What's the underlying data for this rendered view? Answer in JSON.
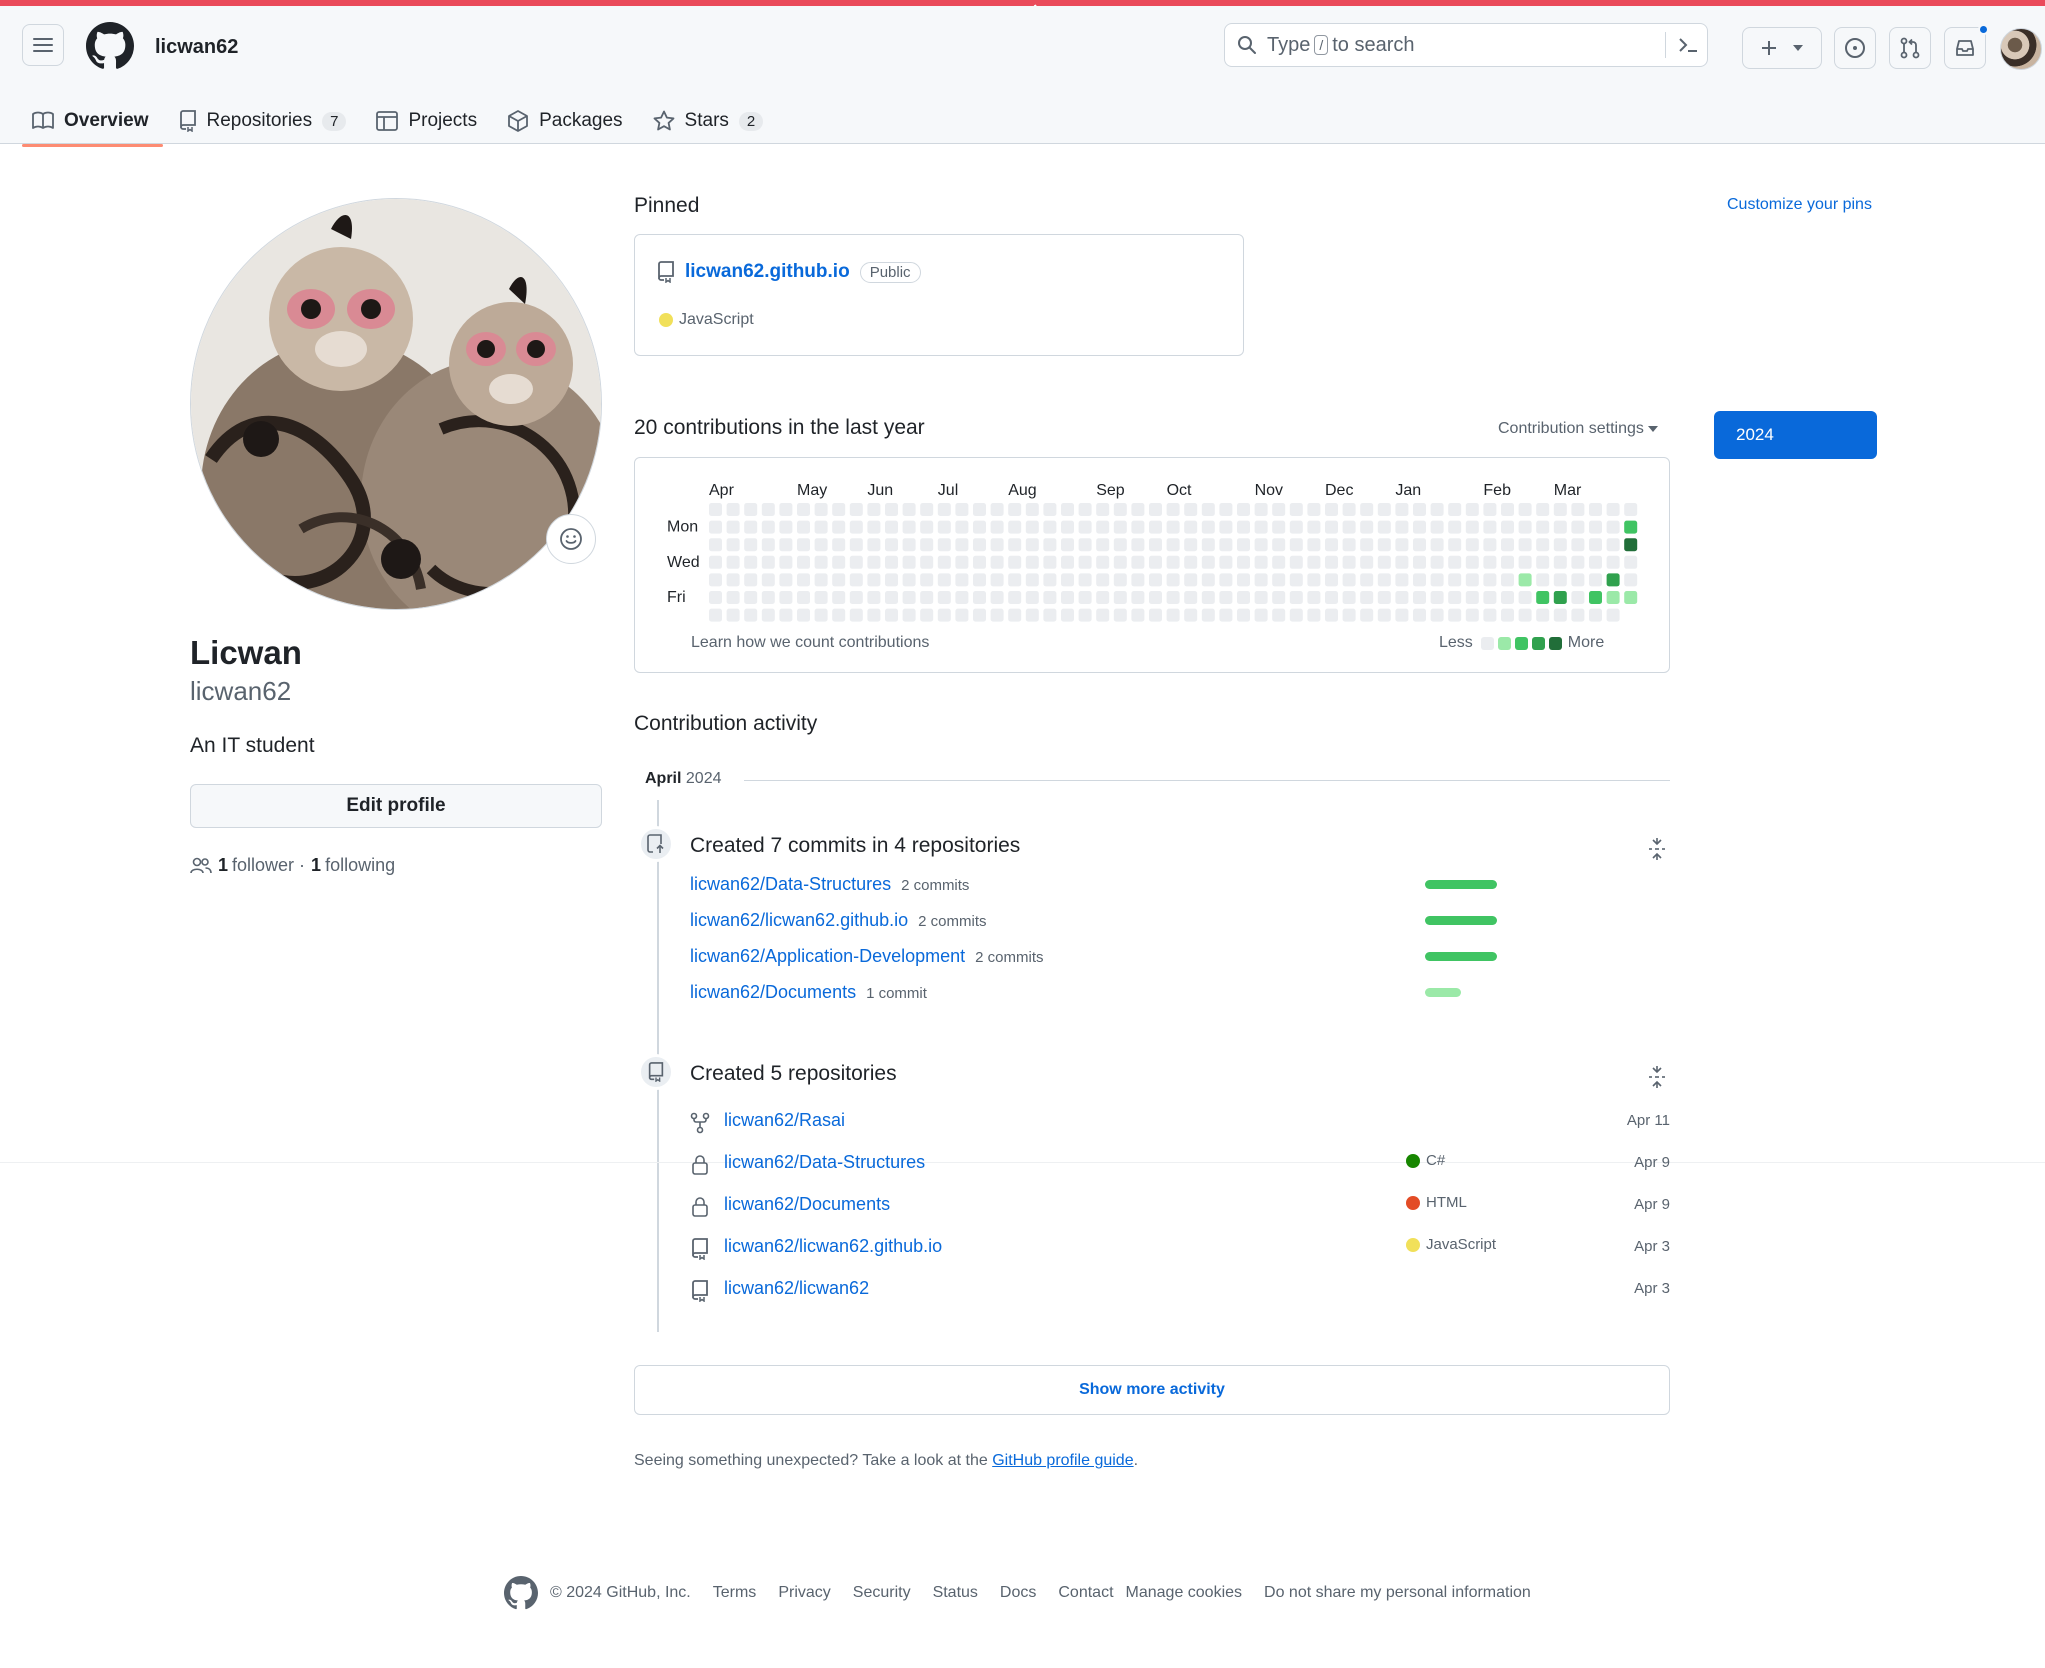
{
  "header": {
    "username": "licwan62",
    "search": {
      "prefix": "Type",
      "slash": "/",
      "suffix": "to search"
    }
  },
  "tabs": [
    {
      "label": "Overview",
      "icon": "book-icon"
    },
    {
      "label": "Repositories",
      "icon": "repo-icon",
      "count": "7"
    },
    {
      "label": "Projects",
      "icon": "table-icon"
    },
    {
      "label": "Packages",
      "icon": "package-icon"
    },
    {
      "label": "Stars",
      "icon": "star-icon",
      "count": "2"
    }
  ],
  "profile": {
    "name": "Licwan",
    "username": "licwan62",
    "bio": "An IT student",
    "edit_label": "Edit profile",
    "followers": "1",
    "followers_label": "follower",
    "following": "1",
    "following_label": "following"
  },
  "pinned": {
    "title": "Pinned",
    "customize": "Customize your pins",
    "repo": "licwan62.github.io",
    "visibility": "Public",
    "language": "JavaScript",
    "language_color": "#f1e05a"
  },
  "contributions": {
    "title": "20 contributions in the last year",
    "settings": "Contribution settings",
    "year": "2024",
    "months": [
      "Apr",
      "May",
      "Jun",
      "Jul",
      "Aug",
      "Sep",
      "Oct",
      "Nov",
      "Dec",
      "Jan",
      "Feb",
      "Mar"
    ],
    "days": [
      "Mon",
      "Wed",
      "Fri"
    ],
    "learn": "Learn how we count contributions",
    "less": "Less",
    "more": "More",
    "level_colors": [
      "#ebedf0",
      "#9be9a8",
      "#40c463",
      "#30a14e",
      "#216e39"
    ],
    "active_cells": [
      {
        "week": 46,
        "day": 4,
        "level": 1
      },
      {
        "week": 47,
        "day": 5,
        "level": 2
      },
      {
        "week": 48,
        "day": 5,
        "level": 3
      },
      {
        "week": 50,
        "day": 5,
        "level": 2
      },
      {
        "week": 51,
        "day": 4,
        "level": 3
      },
      {
        "week": 51,
        "day": 5,
        "level": 1
      },
      {
        "week": 52,
        "day": 1,
        "level": 2
      },
      {
        "week": 52,
        "day": 2,
        "level": 4
      },
      {
        "week": 52,
        "day": 5,
        "level": 1
      }
    ]
  },
  "activity": {
    "title": "Contribution activity",
    "month": "April",
    "year": "2024",
    "commits_title": "Created 7 commits in 4 repositories",
    "commits": [
      {
        "repo": "licwan62/Data-Structures",
        "count": "2 commits",
        "fraction": 1.0,
        "color": "#40c463"
      },
      {
        "repo": "licwan62/licwan62.github.io",
        "count": "2 commits",
        "fraction": 1.0,
        "color": "#40c463"
      },
      {
        "repo": "licwan62/Application-Development",
        "count": "2 commits",
        "fraction": 1.0,
        "color": "#40c463"
      },
      {
        "repo": "licwan62/Documents",
        "count": "1 commit",
        "fraction": 0.5,
        "color": "#9be9a8"
      }
    ],
    "repos_title": "Created 5 repositories",
    "repos": [
      {
        "name": "licwan62/Rasai",
        "icon": "fork-icon",
        "language": "",
        "language_color": "",
        "date": "Apr 11"
      },
      {
        "name": "licwan62/Data-Structures",
        "icon": "lock-icon",
        "language": "C#",
        "language_color": "#178600",
        "date": "Apr 9"
      },
      {
        "name": "licwan62/Documents",
        "icon": "lock-icon",
        "language": "HTML",
        "language_color": "#e34c26",
        "date": "Apr 9"
      },
      {
        "name": "licwan62/licwan62.github.io",
        "icon": "repo-icon",
        "language": "JavaScript",
        "language_color": "#f1e05a",
        "date": "Apr 3"
      },
      {
        "name": "licwan62/licwan62",
        "icon": "repo-icon",
        "language": "",
        "language_color": "",
        "date": "Apr 3"
      }
    ],
    "show_more": "Show more activity",
    "unexpected_text": "Seeing something unexpected? Take a look at the",
    "unexpected_link": "GitHub profile guide",
    "unexpected_end": "."
  },
  "footer": {
    "copyright": "© 2024 GitHub, Inc.",
    "links": [
      "Terms",
      "Privacy",
      "Security",
      "Status",
      "Docs",
      "Contact",
      "Manage cookies",
      "Do not share my personal information"
    ]
  }
}
